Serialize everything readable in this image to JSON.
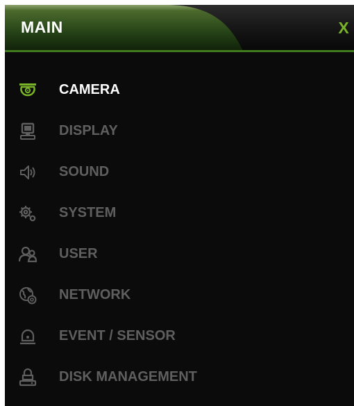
{
  "window": {
    "title": "MAIN",
    "close_label": "X"
  },
  "colors": {
    "accent": "#79b428",
    "active_text": "#ffffff",
    "inactive_text": "#5f5f5f",
    "panel_background": "#0b0b0b"
  },
  "menu": {
    "items": [
      {
        "label": "CAMERA",
        "icon": "camera-icon",
        "active": true
      },
      {
        "label": "DISPLAY",
        "icon": "display-icon",
        "active": false
      },
      {
        "label": "SOUND",
        "icon": "sound-icon",
        "active": false
      },
      {
        "label": "SYSTEM",
        "icon": "system-gear-icon",
        "active": false
      },
      {
        "label": "USER",
        "icon": "user-icon",
        "active": false
      },
      {
        "label": "NETWORK",
        "icon": "network-icon",
        "active": false
      },
      {
        "label": "EVENT / SENSOR",
        "icon": "event-sensor-icon",
        "active": false
      },
      {
        "label": "DISK MANAGEMENT",
        "icon": "disk-management-icon",
        "active": false
      }
    ]
  }
}
